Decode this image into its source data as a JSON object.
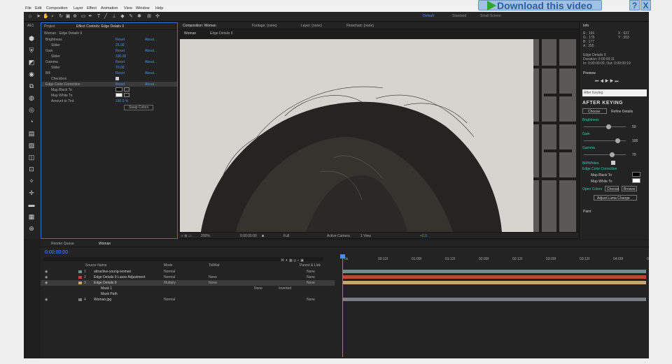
{
  "menu": [
    "File",
    "Edit",
    "Composition",
    "Layer",
    "Effect",
    "Animation",
    "View",
    "Window",
    "Help"
  ],
  "workspaces": [
    "Default",
    "Standard",
    "Small Screen"
  ],
  "banner": {
    "download_label": "Download this video",
    "help": "?",
    "close": "X"
  },
  "panels": {
    "project": "Project",
    "effect_controls": "Effect Controls: Edge Details 9",
    "layer_name": "Woman · Edge Details 9",
    "composition_tab": "Composition: Woman",
    "footage_tab": "Footage: (none)",
    "layer_tab": "Layer: (none)",
    "flowchart_tab": "Flowchart: (none)",
    "comp_sub1": "Woman",
    "comp_sub2": "Edge Details 9",
    "info": "Info",
    "preview": "Preview",
    "paint": "Paint",
    "render_queue": "Render Queue",
    "timeline_tab": "Woman"
  },
  "effect_props": [
    {
      "name": "Brightness",
      "v1": "Reset",
      "v2": "About..."
    },
    {
      "name": "Slider",
      "v1": "25.00",
      "v2": ""
    },
    {
      "name": "Gain",
      "v1": "Reset",
      "v2": "About..."
    },
    {
      "name": "Slider",
      "v1": "100.00",
      "v2": ""
    },
    {
      "name": "Gamma",
      "v1": "Reset",
      "v2": "About..."
    },
    {
      "name": "Slider",
      "v1": "70.00",
      "v2": ""
    },
    {
      "name": "Bill",
      "v1": "Reset",
      "v2": "About..."
    },
    {
      "name": "Checkbox",
      "v1": "",
      "v2": ""
    },
    {
      "name": "Edge Color Correction",
      "v1": "Reset",
      "v2": "About..."
    },
    {
      "name": "Map Black To",
      "v1": "",
      "v2": ""
    },
    {
      "name": "Map White To",
      "v1": "",
      "v2": ""
    },
    {
      "name": "Amount to Tint",
      "v1": "100.0 %",
      "v2": ""
    },
    {
      "name": "",
      "v1": "Swap Colors",
      "v2": ""
    }
  ],
  "viewer_footer": {
    "zoom": "200%",
    "time": "0:00:00:00",
    "res": "Full",
    "camera": "Active Camera",
    "views": "1 View",
    "offset": "+0.0"
  },
  "info": {
    "r": "R : 166",
    "g": "G : 175",
    "b": "B : 177",
    "a": "A : 255",
    "x": "X : 637",
    "y": "Y : 353",
    "layer": "Edge Details 9",
    "duration": "Duration: 0:00:00:11",
    "inout": "In: 0:00:00:00, Out: 0:00:00:10"
  },
  "plugin": {
    "search": "After Keying",
    "logo": "AFTER KEYING",
    "choose": "Choose",
    "refine": "Refine Details",
    "brightness": "Brightness",
    "gain": "Gain",
    "gamma": "Gamma",
    "brightness_val": "50",
    "gain_val": "100",
    "gamma_val": "70",
    "bill": "Bill/Whites",
    "edge_cc": "Edge Color Correction",
    "map_black": "Map Black To",
    "map_white": "Map White To",
    "open_colors": "Open Colors",
    "choose2": "Choose",
    "browse": "Browse",
    "adjust": "Adjust Luma Change"
  },
  "timeline": {
    "timecode": "0:00:00:00",
    "col_source": "Source Name",
    "col_mode": "Mode",
    "col_trkmat": "TrkMat",
    "col_parent": "Parent & Link",
    "layers": [
      {
        "num": "1",
        "name": "attractive-young-woman",
        "mode": "Normal",
        "trk": "",
        "parent": "None",
        "color": "#6f8f8e"
      },
      {
        "num": "2",
        "name": "Edge Details 9 Lasso Adjustment",
        "mode": "Normal",
        "trk": "None",
        "parent": "None",
        "color": "#b44a3d"
      },
      {
        "num": "3",
        "name": "Edge Details 9",
        "mode": "Multiply",
        "trk": "None",
        "parent": "None",
        "color": "#c9a37a"
      },
      {
        "num": "",
        "name": "Mask 1",
        "mode": "",
        "trk": "None",
        "parent": "Inverted",
        "color": ""
      },
      {
        "num": "",
        "name": "Mask Path",
        "mode": "",
        "trk": "",
        "parent": "",
        "color": ""
      },
      {
        "num": "4",
        "name": "Woman.jpg",
        "mode": "Normal",
        "trk": "",
        "parent": "None",
        "color": "#7a7d86"
      }
    ],
    "ruler": [
      "0s",
      "00:12f",
      "01:00f",
      "01:12f",
      "02:00f",
      "02:12f",
      "03:00f",
      "03:12f",
      "04:00f",
      "04:12f"
    ]
  }
}
